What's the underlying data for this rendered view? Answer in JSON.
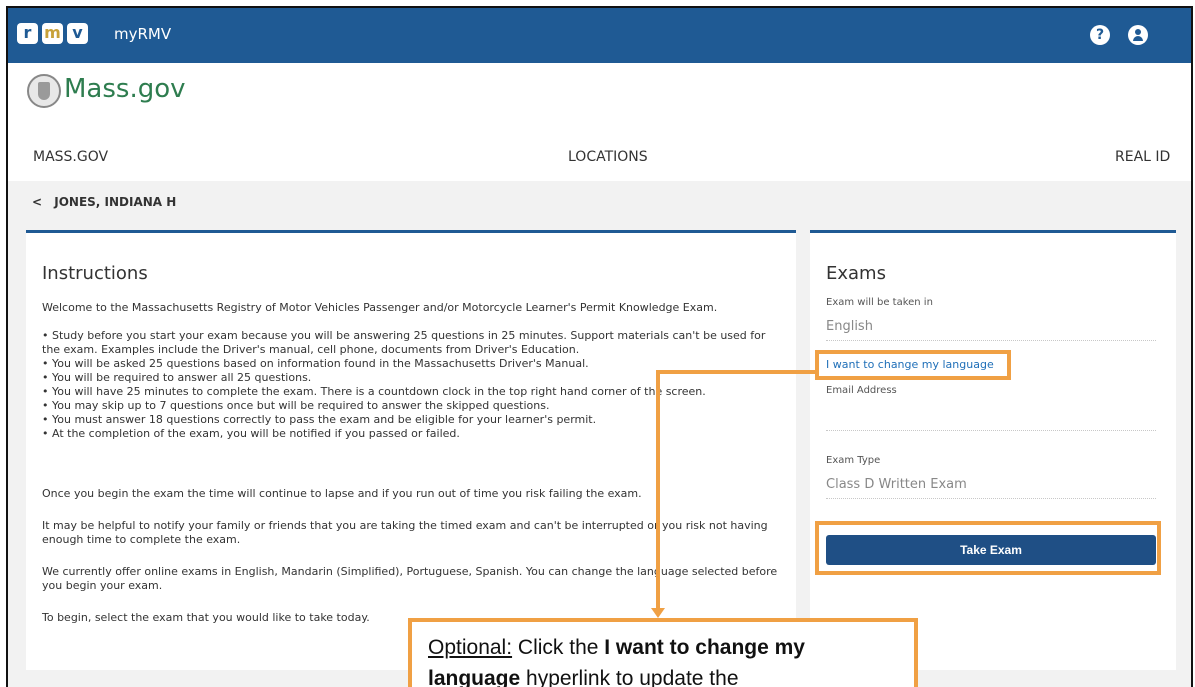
{
  "topbar": {
    "logo_letters": [
      "r",
      "m",
      "v"
    ],
    "app_name": "myRMV"
  },
  "header": {
    "brand": "Mass.gov",
    "nav": [
      "MASS.GOV",
      "LOCATIONS",
      "REAL ID"
    ]
  },
  "breadcrumb": {
    "chevron": "<",
    "name": "JONES, INDIANA H"
  },
  "instructions": {
    "title": "Instructions",
    "welcome": "Welcome to the Massachusetts Registry of Motor Vehicles Passenger and/or Motorcycle Learner's Permit Knowledge Exam.",
    "bullets": [
      "• Study before you start your exam because you will be answering 25 questions in 25 minutes. Support materials can't be used for the exam. Examples include the Driver's manual, cell phone, documents from Driver's Education.",
      "• You will be asked 25 questions based on information found in the Massachusetts Driver's Manual.",
      "• You will be required to answer all 25 questions.",
      "• You will have 25 minutes to complete the exam. There is a countdown clock in the top right hand corner of the screen.",
      "• You may skip up to 7 questions once but will be required to answer the skipped questions.",
      "• You must answer 18 questions correctly to pass the exam and be eligible for your learner's permit.",
      "• At the completion of the exam, you will be notified if you passed or failed."
    ],
    "para_time": "Once you begin the exam the time will continue to lapse and if you run out of time you risk failing the exam.",
    "para_notify": "It may be helpful to notify your family or friends that you are taking the timed exam and can't be interrupted or you risk not having enough time to complete the exam.",
    "para_languages": "We currently offer online exams in English, Mandarin (Simplified), Portuguese, Spanish. You can change the language selected before you begin your exam.",
    "para_begin": "To begin, select the exam that you would like to take today."
  },
  "exams": {
    "title": "Exams",
    "language_label": "Exam will be taken in",
    "language_value": "English",
    "change_language_link": "I want to change my language",
    "email_label": "Email Address",
    "email_value": "",
    "type_label": "Exam Type",
    "type_value": "Class D Written Exam",
    "take_exam_button": "Take Exam"
  },
  "callout": {
    "optional": "Optional:",
    "text_1": " Click the ",
    "bold_1": "I want to c",
    "bold_2": "hange my language",
    "text_2": " hyperlink to update the"
  },
  "colors": {
    "topbar": "#1f5a94",
    "brand_green": "#2e7d4f",
    "annotation_orange": "#f0a044",
    "button_blue": "#1f4f85",
    "link_blue": "#1f6fb8"
  }
}
